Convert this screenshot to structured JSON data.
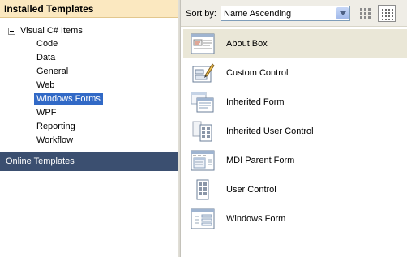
{
  "left_pane": {
    "header": "Installed Templates",
    "root": {
      "label": "Visual C# Items",
      "expanded": true
    },
    "items": [
      {
        "label": "Code",
        "selected": false
      },
      {
        "label": "Data",
        "selected": false
      },
      {
        "label": "General",
        "selected": false
      },
      {
        "label": "Web",
        "selected": false
      },
      {
        "label": "Windows Forms",
        "selected": true
      },
      {
        "label": "WPF",
        "selected": false
      },
      {
        "label": "Reporting",
        "selected": false
      },
      {
        "label": "Workflow",
        "selected": false
      }
    ],
    "online_templates": "Online Templates"
  },
  "toolbar": {
    "sort_label": "Sort by:",
    "sort_value": "Name Ascending",
    "views": [
      {
        "icon": "medium-icons-view-icon",
        "active": false
      },
      {
        "icon": "small-icons-view-icon",
        "active": true
      }
    ]
  },
  "templates": [
    {
      "label": "About Box",
      "icon": "about-box-icon",
      "selected": true
    },
    {
      "label": "Custom Control",
      "icon": "custom-control-icon",
      "selected": false
    },
    {
      "label": "Inherited Form",
      "icon": "inherited-form-icon",
      "selected": false
    },
    {
      "label": "Inherited User Control",
      "icon": "inherited-user-control-icon",
      "selected": false
    },
    {
      "label": "MDI Parent Form",
      "icon": "mdi-parent-form-icon",
      "selected": false
    },
    {
      "label": "User Control",
      "icon": "user-control-icon",
      "selected": false
    },
    {
      "label": "Windows Form",
      "icon": "windows-form-icon",
      "selected": false
    }
  ],
  "colors": {
    "header_bg": "#fbe8c0",
    "selection": "#3169c6",
    "online_bg": "#3b4f70",
    "row_selected": "#eae7d7"
  }
}
